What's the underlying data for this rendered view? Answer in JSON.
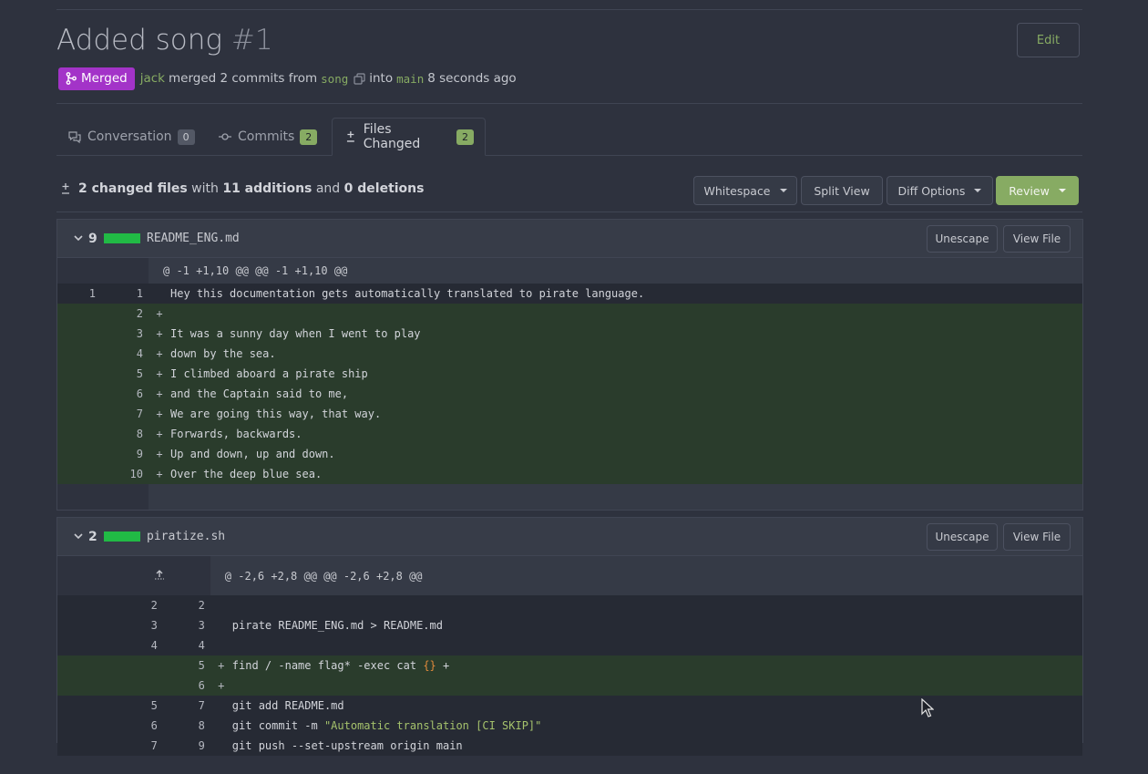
{
  "pr": {
    "title": "Added song",
    "number": "#1",
    "edit_label": "Edit",
    "status": "Merged",
    "author": "jack",
    "merged_text": "merged 2 commits from",
    "source_branch": "song",
    "into_text": "into",
    "target_branch": "main",
    "time_ago": "8 seconds ago"
  },
  "tabs": [
    {
      "label": "Conversation",
      "count": "0"
    },
    {
      "label": "Commits",
      "count": "2"
    },
    {
      "label": "Files Changed",
      "count": "2"
    }
  ],
  "summary": {
    "files": "2 changed files",
    "with": "with",
    "additions": "11 additions",
    "and": "and",
    "deletions": "0 deletions"
  },
  "toolbar": {
    "whitespace": "Whitespace",
    "split_view": "Split View",
    "diff_options": "Diff Options",
    "review": "Review"
  },
  "files": [
    {
      "count": "9",
      "name": "README_ENG.md",
      "unescape": "Unescape",
      "view_file": "View File",
      "hunk": "@ -1 +1,10 @@ @@ -1 +1,10 @@",
      "lines": [
        {
          "old": "1",
          "new": "1",
          "sign": "",
          "code": "Hey this documentation gets automatically translated to pirate language."
        },
        {
          "old": "",
          "new": "2",
          "sign": "+",
          "code": ""
        },
        {
          "old": "",
          "new": "3",
          "sign": "+",
          "code": "It was a sunny day when I went to play"
        },
        {
          "old": "",
          "new": "4",
          "sign": "+",
          "code": "down by the sea."
        },
        {
          "old": "",
          "new": "5",
          "sign": "+",
          "code": "I climbed aboard a pirate ship"
        },
        {
          "old": "",
          "new": "6",
          "sign": "+",
          "code": "and the Captain said to me,"
        },
        {
          "old": "",
          "new": "7",
          "sign": "+",
          "code": "We are going this way, that way."
        },
        {
          "old": "",
          "new": "8",
          "sign": "+",
          "code": "Forwards, backwards."
        },
        {
          "old": "",
          "new": "9",
          "sign": "+",
          "code": "Up and down, up and down."
        },
        {
          "old": "",
          "new": "10",
          "sign": "+",
          "code": "Over the deep blue sea."
        }
      ]
    },
    {
      "count": "2",
      "name": "piratize.sh",
      "unescape": "Unescape",
      "view_file": "View File",
      "hunk": "@ -2,6 +2,8 @@ @@ -2,6 +2,8 @@",
      "lines": [
        {
          "old": "2",
          "new": "2",
          "sign": "",
          "code": ""
        },
        {
          "old": "3",
          "new": "3",
          "sign": "",
          "code": "pirate README_ENG.md > README.md"
        },
        {
          "old": "4",
          "new": "4",
          "sign": "",
          "code": ""
        },
        {
          "old": "",
          "new": "5",
          "sign": "+",
          "code_a": "find / -name flag* -exec cat ",
          "code_b": "{}",
          "code_c": " +"
        },
        {
          "old": "",
          "new": "6",
          "sign": "+",
          "code": ""
        },
        {
          "old": "5",
          "new": "7",
          "sign": "",
          "code": "git add README.md"
        },
        {
          "old": "6",
          "new": "8",
          "sign": "",
          "code_a": "git commit -m ",
          "code_b": "\"Automatic translation [CI SKIP]\""
        },
        {
          "old": "7",
          "new": "9",
          "sign": "",
          "code": "git push --set-upstream origin main"
        }
      ]
    }
  ],
  "colors": {
    "accent_green": "#87ab63",
    "merged_purple": "#a333c8",
    "addition_bar": "#21ba45"
  }
}
